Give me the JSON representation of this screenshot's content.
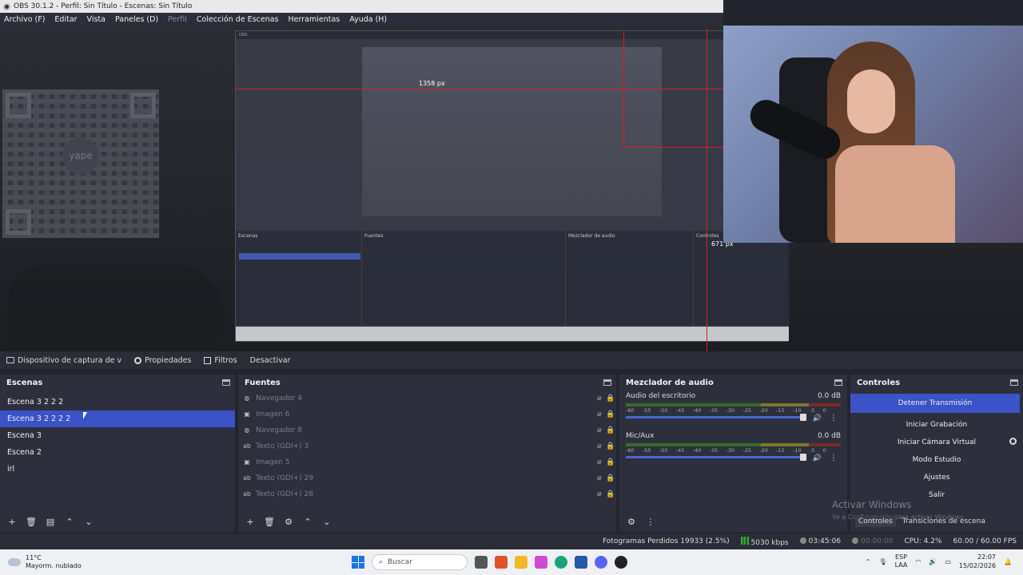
{
  "window": {
    "title": "OBS 30.1.2 - Perfil: Sin Título - Escenas: Sin Título"
  },
  "menu": [
    {
      "label": "Archivo (F)"
    },
    {
      "label": "Editar"
    },
    {
      "label": "Vista"
    },
    {
      "label": "Paneles (D)"
    },
    {
      "label": "Perfil"
    },
    {
      "label": "Colección de Escenas"
    },
    {
      "label": "Herramientas"
    },
    {
      "label": "Ayuda (H)"
    }
  ],
  "preview": {
    "width_label": "1358 px",
    "height_label": "671 px"
  },
  "source_toolbar": {
    "source_name": "Dispositivo de captura de v",
    "properties": "Propiedades",
    "filters": "Filtros",
    "deactivate": "Desactivar"
  },
  "scenes": {
    "title": "Escenas",
    "items": [
      {
        "label": "Escena 3 2 2 2"
      },
      {
        "label": "Escena 3 2 2 2 2"
      },
      {
        "label": "Escena 3"
      },
      {
        "label": "Escena 2"
      },
      {
        "label": "irl"
      }
    ],
    "selected_index": 1
  },
  "sources": {
    "title": "Fuentes",
    "items": [
      {
        "label": "Navegador 4",
        "icon": "globe-icon"
      },
      {
        "label": "Imagen 6",
        "icon": "image-icon"
      },
      {
        "label": "Navegador 8",
        "icon": "globe-icon"
      },
      {
        "label": "Texto (GDI+) 3",
        "icon": "text-icon"
      },
      {
        "label": "Imagen 5",
        "icon": "image-icon"
      },
      {
        "label": "Texto (GDI+) 29",
        "icon": "text-icon"
      },
      {
        "label": "Texto (GDI+) 28",
        "icon": "text-icon"
      }
    ]
  },
  "mixer": {
    "title": "Mezclador de audio",
    "channels": [
      {
        "name": "Audio del escritorio",
        "db": "0.0 dB"
      },
      {
        "name": "Mic/Aux",
        "db": "0.0 dB"
      }
    ],
    "ticks": [
      "-60",
      "-55",
      "-50",
      "-45",
      "-40",
      "-35",
      "-30",
      "-25",
      "-20",
      "-15",
      "-10",
      "-5",
      "0"
    ]
  },
  "controls": {
    "title": "Controles",
    "stop_stream": "Detener Transmisión",
    "start_recording": "Iniciar Grabación",
    "start_virtual_cam": "Iniciar Cámara Virtual",
    "studio_mode": "Modo Estudio",
    "settings": "Ajustes",
    "exit": "Salir",
    "tab_controls": "Controles",
    "tab_transitions": "Transiciones de escena"
  },
  "activate_windows": {
    "title": "Activar Windows",
    "subtitle": "Ve a Configuración para activar Windows."
  },
  "status": {
    "dropped_frames": "Fotogramas Perdidos 19933 (2.5%)",
    "bitrate": "5030 kbps",
    "live_time": "03:45:06",
    "rec_time": "00:00:00",
    "cpu": "CPU: 4.2%",
    "fps": "60.00 / 60.00 FPS"
  },
  "taskbar": {
    "temperature": "11°C",
    "weather": "Mayorm. nublado",
    "search": "Buscar",
    "lang": "ESP",
    "lang2": "LAA",
    "time": "22:07",
    "date": "15/02/2026"
  }
}
